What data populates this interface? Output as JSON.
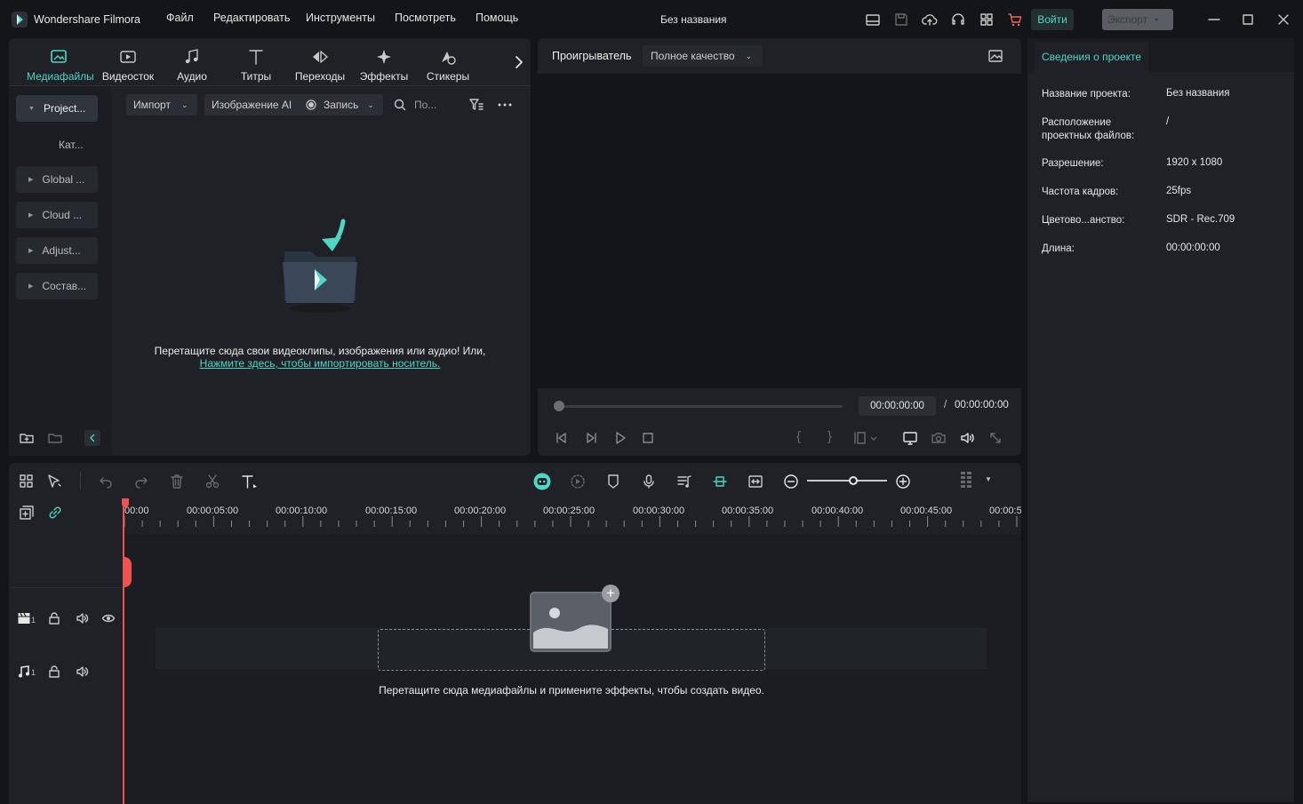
{
  "app": {
    "name": "Wondershare Filmora",
    "project_title": "Без названия"
  },
  "menu": [
    "Файл",
    "Редактировать",
    "Инструменты",
    "Посмотреть",
    "Помощь"
  ],
  "header_buttons": {
    "login": "Войти",
    "export": "Экспорт"
  },
  "toolbar_tabs": [
    "Медиафайлы",
    "Видеосток",
    "Аудио",
    "Титры",
    "Переходы",
    "Эффекты",
    "Стикеры"
  ],
  "sidebar": {
    "project": "Project...",
    "category": "Кат...",
    "items": [
      "Global ...",
      "Cloud ...",
      "Adjust...",
      "Состав..."
    ]
  },
  "media_toolbar": {
    "import": "Импорт",
    "ai_image": "Изображение AI",
    "record": "Запись",
    "search_placeholder": "По..."
  },
  "media_empty": {
    "text": "Перетащите сюда свои видеоклипы, изображения или аудио! Или,",
    "link": "Нажмите здесь, чтобы импортировать носитель."
  },
  "player": {
    "tab": "Проигрыватель",
    "quality": "Полное качество",
    "current_time": "00:00:00:00",
    "separator": "/",
    "total_time": "00:00:00:00"
  },
  "project_info": {
    "tab": "Сведения о проекте",
    "rows": [
      {
        "label": "Название проекта:",
        "value": "Без названия"
      },
      {
        "label": "Расположение проектных файлов:",
        "value": "/"
      },
      {
        "label": "Разрешение:",
        "value": "1920 x 1080"
      },
      {
        "label": "Частота кадров:",
        "value": "25fps"
      },
      {
        "label": "Цветово...анство:",
        "value": "SDR - Rec.709"
      },
      {
        "label": "Длина:",
        "value": "00:00:00:00"
      }
    ]
  },
  "timeline": {
    "ruler": [
      "00:00",
      "00:00:05:00",
      "00:00:10:00",
      "00:00:15:00",
      "00:00:20:00",
      "00:00:25:00",
      "00:00:30:00",
      "00:00:35:00",
      "00:00:40:00",
      "00:00:45:00",
      "00:00:5"
    ],
    "video_track_num": "1",
    "audio_track_num": "1",
    "drop_text": "Перетащите сюда медиафайлы и примените эффекты, чтобы создать видео."
  },
  "colors": {
    "accent": "#4fd6c5",
    "background": "#141519",
    "panel": "#1f2126",
    "playhead": "#ef5350"
  }
}
